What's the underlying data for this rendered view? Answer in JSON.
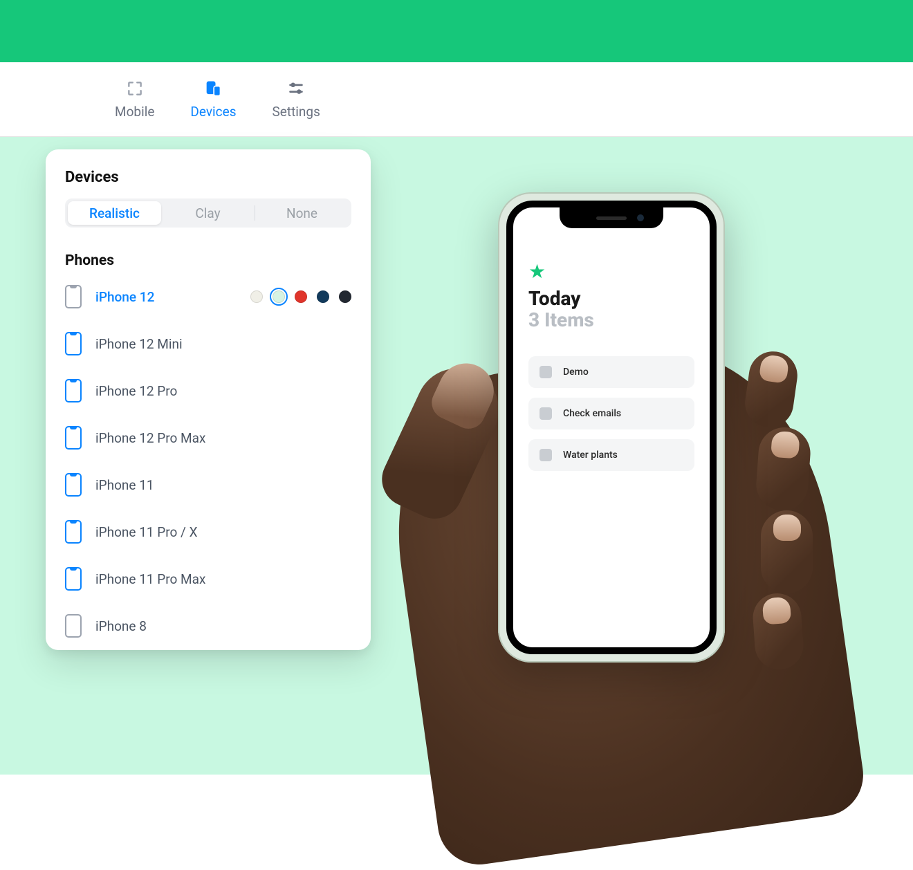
{
  "toolbar": {
    "items": [
      {
        "label": "Mobile",
        "active": false
      },
      {
        "label": "Devices",
        "active": true
      },
      {
        "label": "Settings",
        "active": false
      }
    ]
  },
  "panel": {
    "title": "Devices",
    "style_segments": [
      "Realistic",
      "Clay",
      "None"
    ],
    "style_selected": "Realistic",
    "section_title": "Phones",
    "devices": [
      {
        "label": "iPhone 12",
        "selected": true,
        "colors": [
          "#f0efe7",
          "#d7f3e3",
          "#e0352b",
          "#123a5c",
          "#222831"
        ],
        "color_selected": 1
      },
      {
        "label": "iPhone 12 Mini"
      },
      {
        "label": "iPhone 12 Pro"
      },
      {
        "label": "iPhone 12 Pro Max"
      },
      {
        "label": "iPhone 11"
      },
      {
        "label": "iPhone 11 Pro / X"
      },
      {
        "label": "iPhone 11 Pro Max"
      },
      {
        "label": "iPhone 8"
      }
    ]
  },
  "preview": {
    "app": {
      "title": "Today",
      "subtitle": "3 Items",
      "todos": [
        {
          "label": "Demo"
        },
        {
          "label": "Check emails"
        },
        {
          "label": "Water plants"
        }
      ]
    }
  },
  "colors": {
    "accent": "#0a84ff",
    "brand_green": "#16c77a",
    "canvas_bg": "#c8f8e1"
  }
}
